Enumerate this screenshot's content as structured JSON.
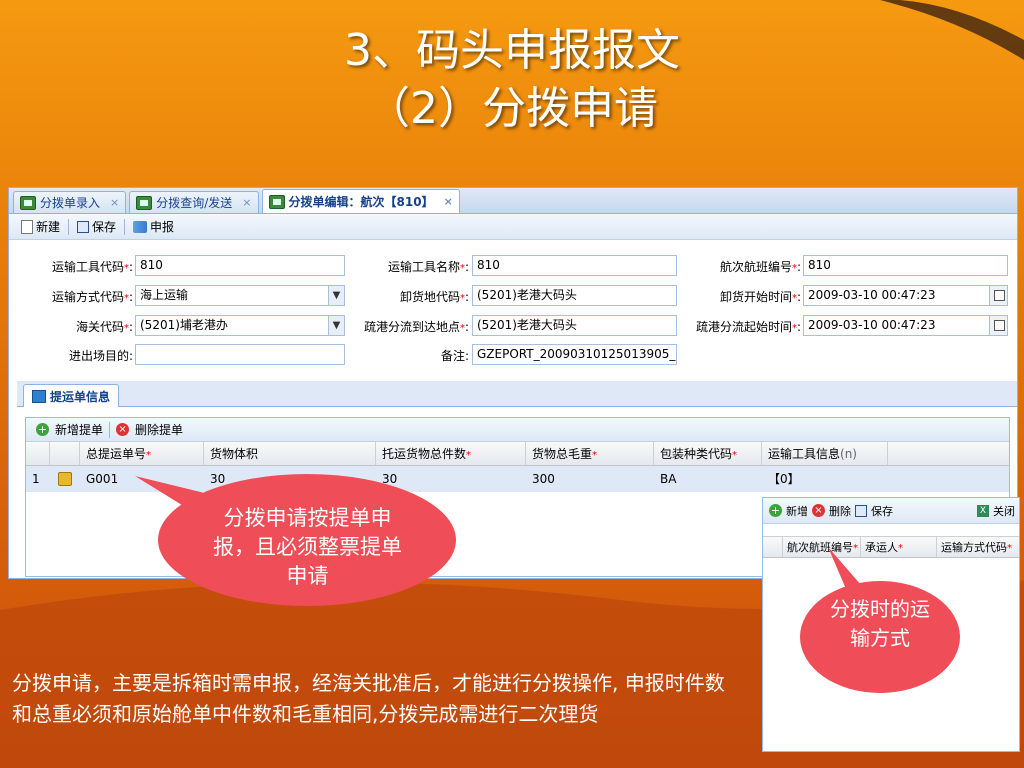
{
  "slide": {
    "title_line1": "3、码头申报报文",
    "title_line2": "（2）分拨申请",
    "bottom_text": "分拨申请，主要是拆箱时需申报，经海关批准后，才能进行分拨操作, 申报时件数和总重必须和原始舱单中件数和毛重相同,分拨完成需进行二次理货"
  },
  "tabs": [
    {
      "label": "分拨单录入",
      "close": "×"
    },
    {
      "label": "分拨查询/发送",
      "close": "×"
    },
    {
      "label": "分拨单编辑：航次【810】",
      "close": "×"
    }
  ],
  "toolbar": {
    "new": "新建",
    "save": "保存",
    "declare": "申报"
  },
  "form": {
    "transport_code_label": "运输工具代码",
    "transport_code_value": "810",
    "transport_name_label": "运输工具名称",
    "transport_name_value": "810",
    "voyage_label": "航次航班编号",
    "voyage_value": "810",
    "transport_mode_label": "运输方式代码",
    "transport_mode_value": "海上运输",
    "unload_place_label": "卸货地代码",
    "unload_place_value": "(5201)老港大码头",
    "unload_start_label": "卸货开始时间",
    "unload_start_value": "2009-03-10 00:47:23",
    "customs_label": "海关代码",
    "customs_value": "(5201)埔老港办",
    "dest_label": "疏港分流到达地点",
    "dest_value": "(5201)老港大码头",
    "dist_start_label": "疏港分流起始时间",
    "dist_start_value": "2009-03-10 00:47:23",
    "purpose_label": "进出场目的",
    "purpose_value": "",
    "remark_label": "备注",
    "remark_value": "GZEPORT_20090310125013905_",
    "req_mark": "*",
    "colon": ":"
  },
  "subpanel": {
    "tab_label": "提运单信息",
    "add_label": "新增提单",
    "delete_label": "删除提单"
  },
  "grid": {
    "columns": [
      "总提运单号",
      "货物体积",
      "托运货物总件数",
      "货物总毛重",
      "包装种类代码",
      "运输工具信息"
    ],
    "required": [
      true,
      false,
      true,
      true,
      true,
      false
    ],
    "column_suffix": "(n)",
    "rows": [
      {
        "index": "1",
        "bill_no": "G001",
        "volume": "30",
        "pieces": "30",
        "weight": "300",
        "package": "BA",
        "transport": "【0】"
      }
    ]
  },
  "bubbles": {
    "left": "分拨申请按提单申报，且必须整票提单申请",
    "right": "分拨时的运输方式"
  },
  "panel2": {
    "add": "新增",
    "delete": "删除",
    "save": "保存",
    "close": "关闭",
    "columns": [
      "航次航班编号",
      "承运人",
      "运输方式代码"
    ]
  },
  "colors": {
    "background": "#e87f0a",
    "bubble": "#ef4d58",
    "panel_blue": "#dfe8f6"
  }
}
